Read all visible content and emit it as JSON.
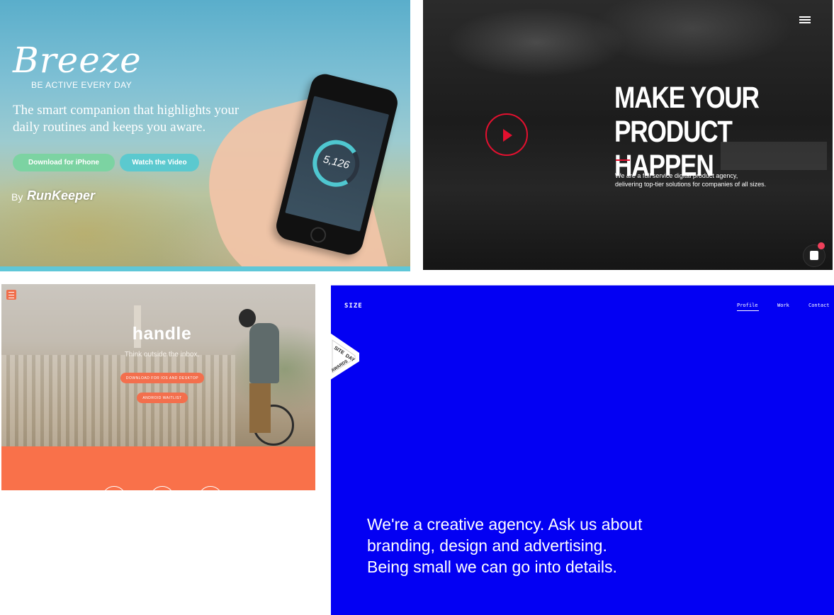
{
  "breeze": {
    "logo": "Breeze",
    "tagline": "BE ACTIVE EVERY DAY",
    "headline": "The smart companion that highlights your daily routines and keeps you aware.",
    "download_button": "Download for iPhone",
    "video_button": "Watch the Video",
    "by_label": "By",
    "brand": "RunKeeper",
    "phone_steps": "5,126",
    "colors": {
      "download": "#7cd3a2",
      "video": "#5bc9cf"
    }
  },
  "agency": {
    "title_line1": "MAKE YOUR",
    "title_line2": "PRODUCT HAPPEN",
    "description_line1": "We are a full service digital product agency,",
    "description_line2": "delivering top-tier solutions for companies of all sizes.",
    "icons": [
      "hamburger-menu-icon",
      "play-icon",
      "chat-icon"
    ],
    "colors": {
      "accent": "#e3102f"
    }
  },
  "handle": {
    "logo": "handle",
    "subtitle": "Think outside the inbox.",
    "download_button": "DOWNLOAD FOR IOS AND DESKTOP",
    "waitlist_button": "ANDROID WAITLIST",
    "colors": {
      "accent": "#f9714a"
    }
  },
  "size": {
    "logo": "SIZE",
    "nav": [
      "Profile",
      "Work",
      "Contact"
    ],
    "badge_line1": "SITE",
    "badge_line2": "DAY",
    "badge_line3": "AWARDS",
    "headline_line1": "We're a creative agency. Ask us about",
    "headline_line2": "branding, design and advertising.",
    "headline_line3": "Being small we can go into details.",
    "colors": {
      "background": "#0300f3"
    }
  }
}
